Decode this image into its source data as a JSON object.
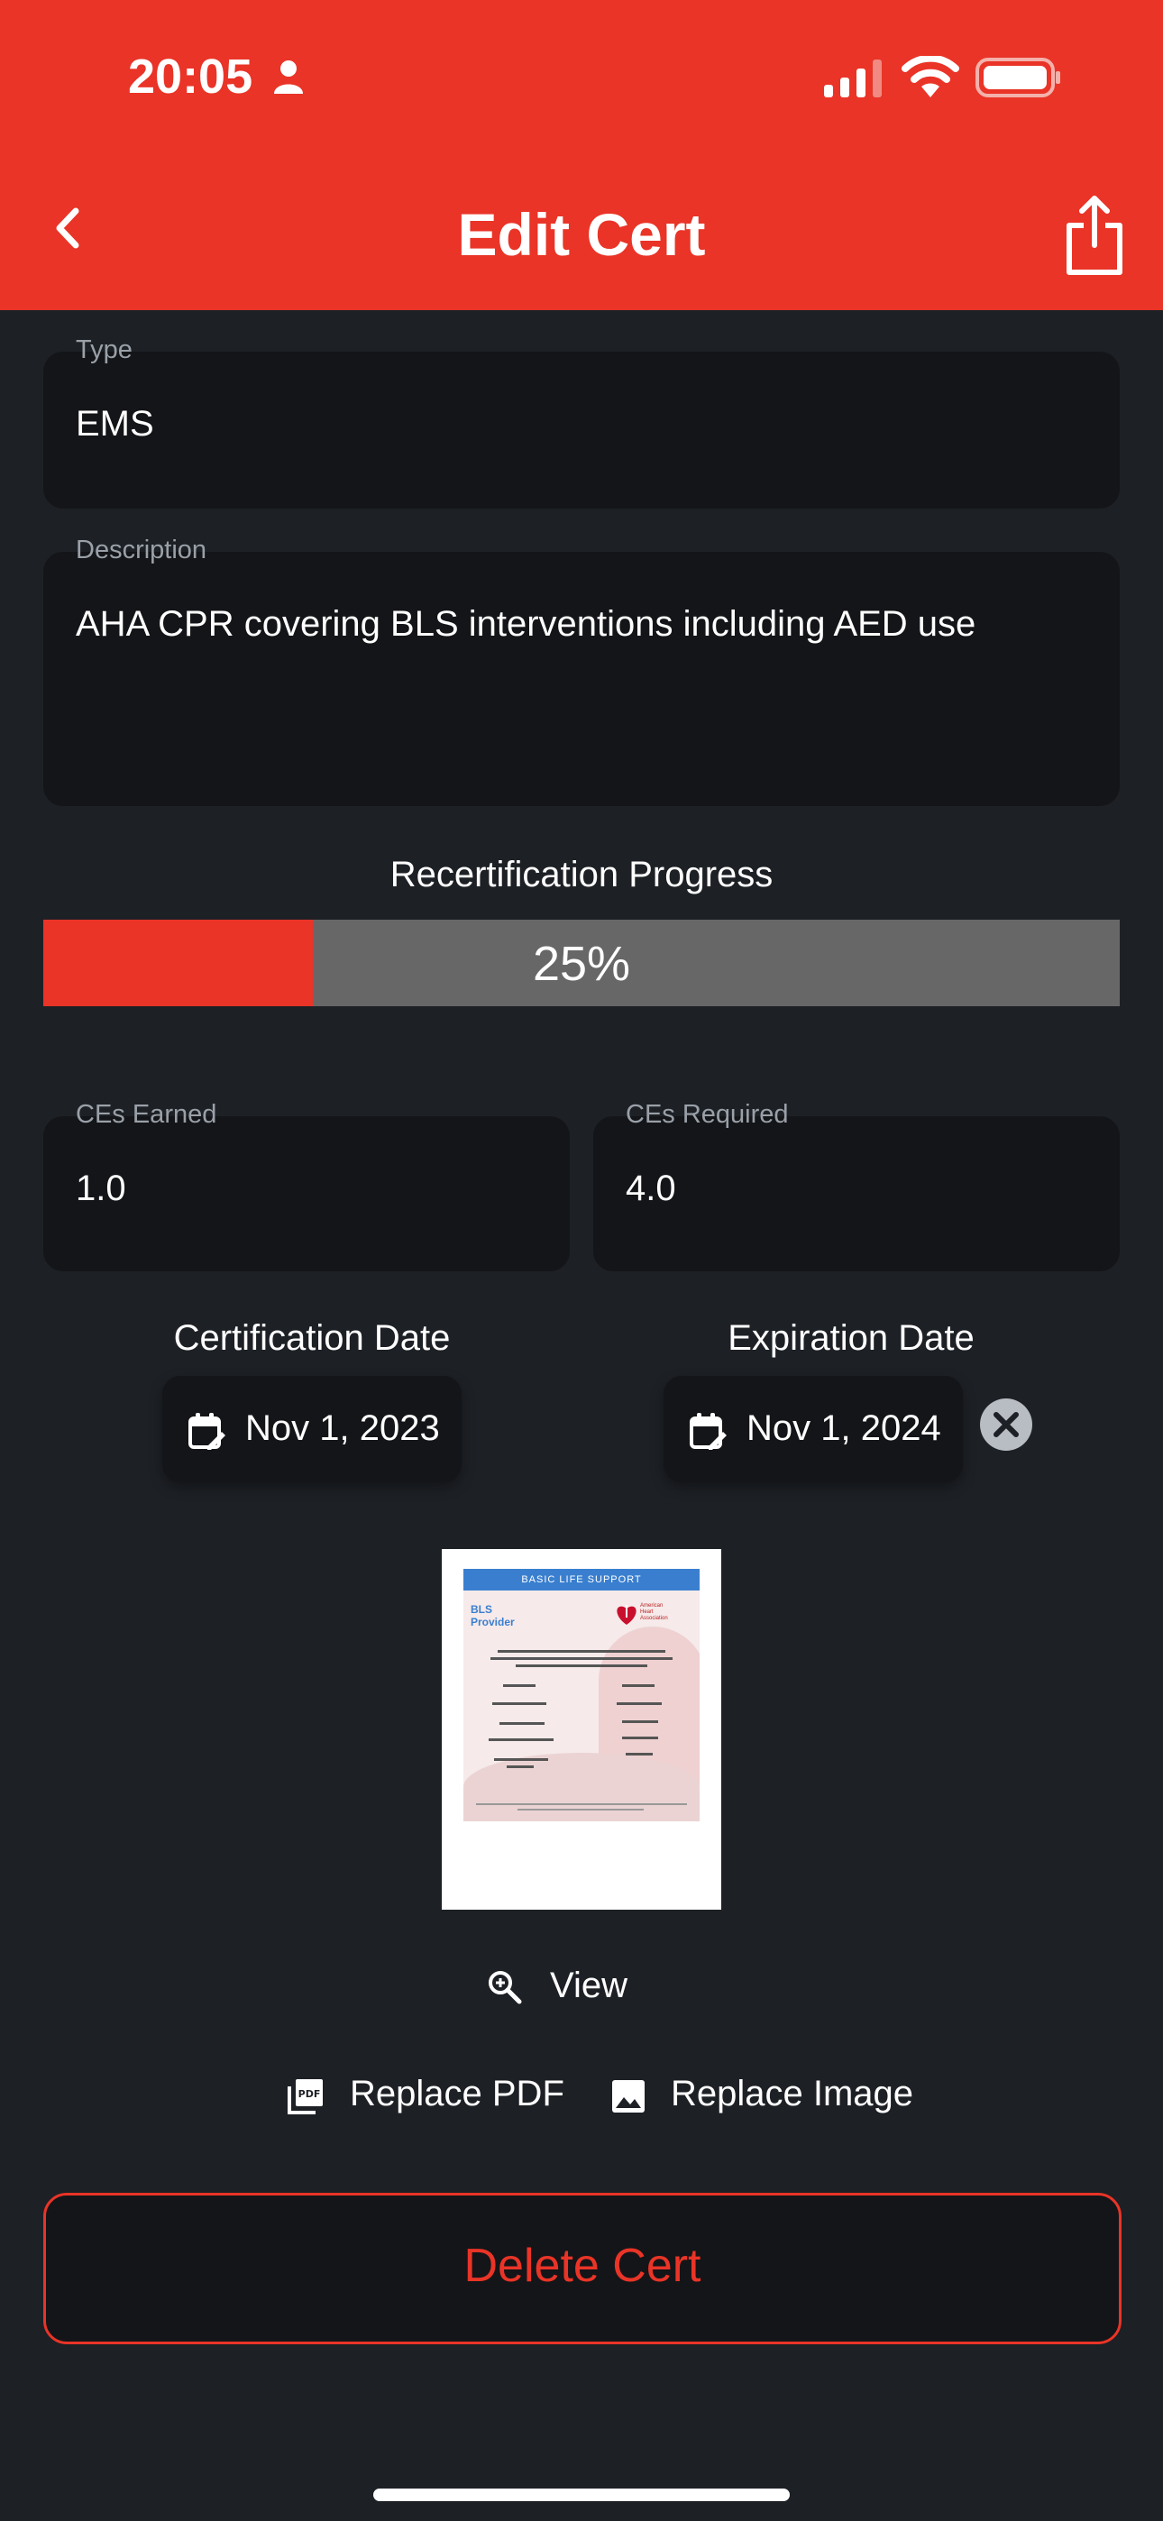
{
  "status_bar": {
    "time": "20:05"
  },
  "header": {
    "title": "Edit Cert"
  },
  "form": {
    "type": {
      "label": "Type",
      "value": "EMS"
    },
    "description": {
      "label": "Description",
      "value": "AHA CPR covering BLS interventions including AED use"
    }
  },
  "progress": {
    "title": "Recertification Progress",
    "percent_text": "25%",
    "fraction": 0.25,
    "fill_color": "#e93427",
    "track_color": "#676767"
  },
  "ces": {
    "earned": {
      "label": "CEs Earned",
      "value": "1.0"
    },
    "required": {
      "label": "CEs Required",
      "value": "4.0"
    }
  },
  "dates": {
    "certification": {
      "label": "Certification Date",
      "value": "Nov 1, 2023"
    },
    "expiration": {
      "label": "Expiration Date",
      "value": "Nov 1, 2024"
    }
  },
  "certificate_preview": {
    "header": "BASIC LIFE SUPPORT",
    "title_line1": "BLS",
    "title_line2": "Provider",
    "org_line1": "American",
    "org_line2": "Heart",
    "org_line3": "Association"
  },
  "actions": {
    "view": "View",
    "replace_pdf": "Replace PDF",
    "replace_image": "Replace Image",
    "delete": "Delete Cert"
  },
  "colors": {
    "accent": "#e93427",
    "background": "#1d2025",
    "field_bg": "#141518"
  },
  "icons": [
    "person-icon",
    "signal-icon",
    "wifi-icon",
    "battery-icon",
    "back-icon",
    "share-icon",
    "calendar-edit-icon",
    "clear-icon",
    "zoom-icon",
    "pdf-icon",
    "image-icon"
  ]
}
